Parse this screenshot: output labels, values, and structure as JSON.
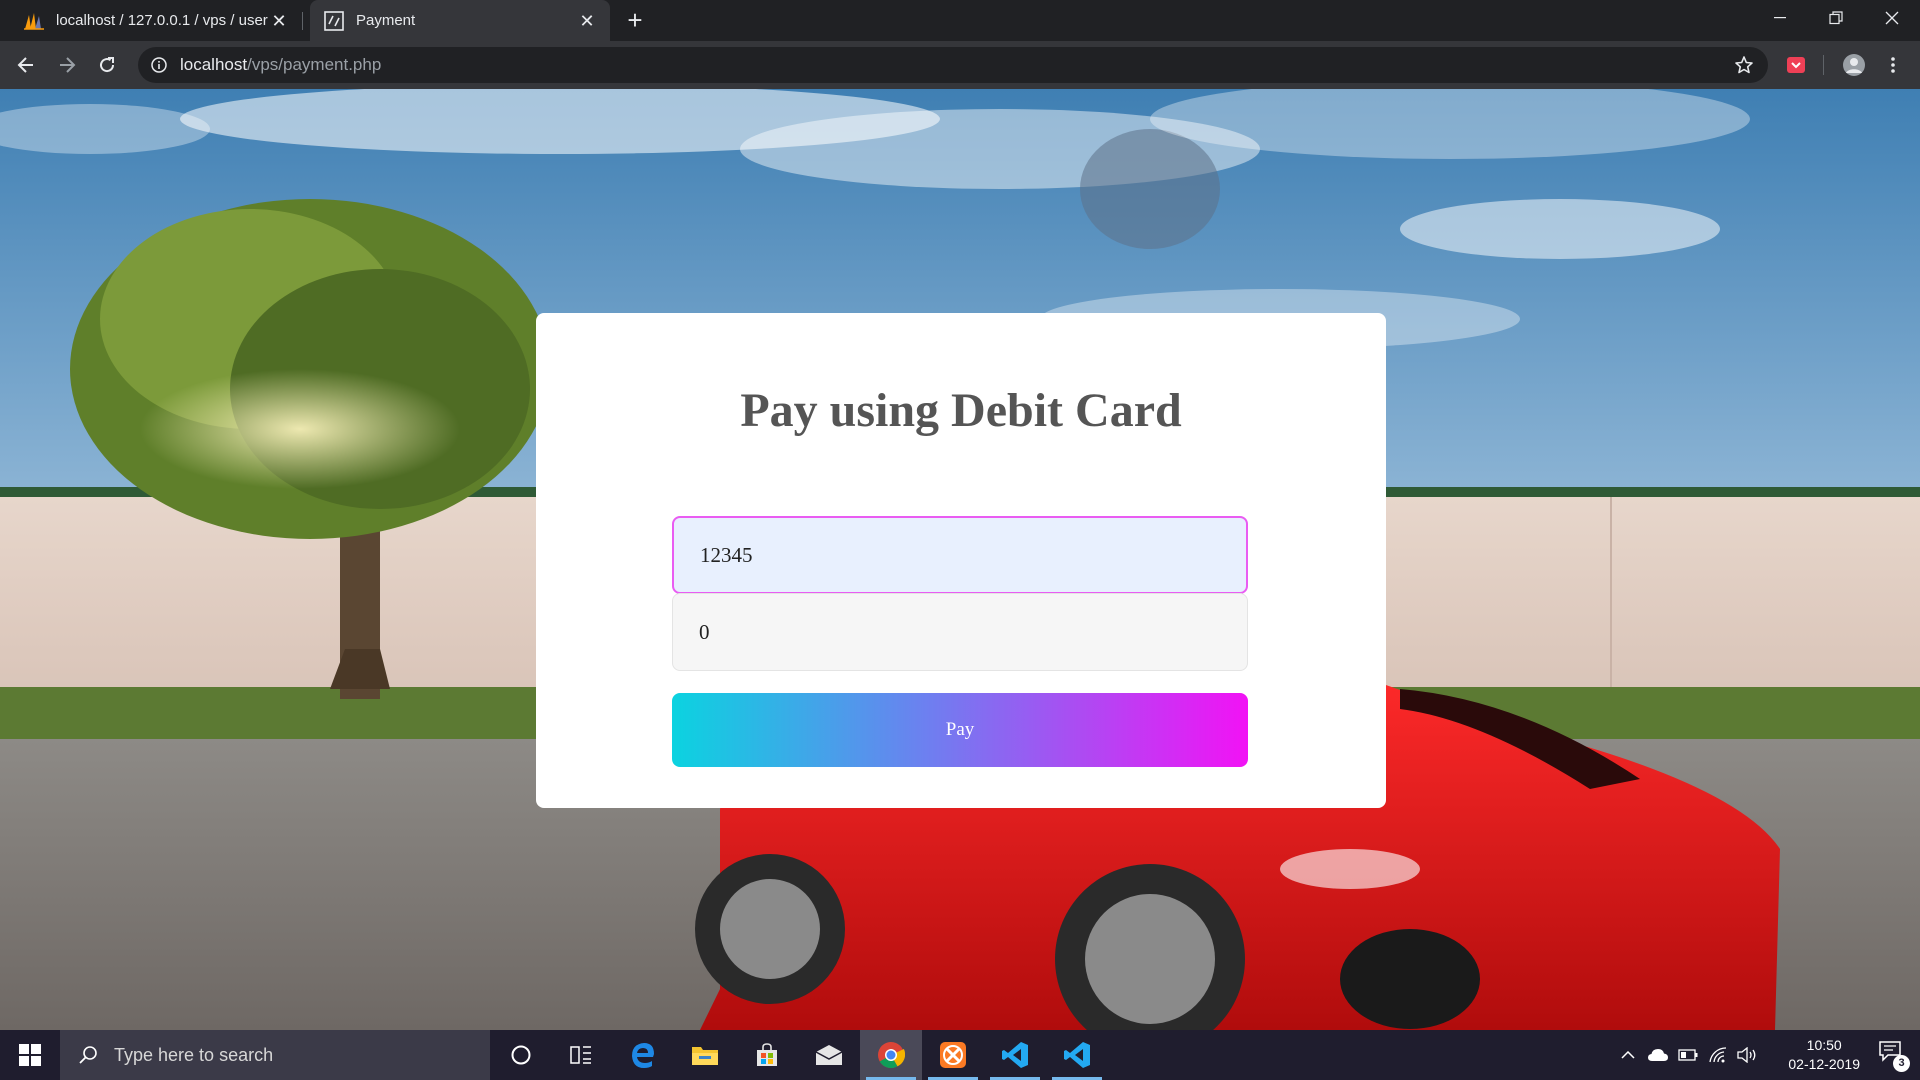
{
  "browser": {
    "tabs": [
      {
        "title": "localhost / 127.0.0.1 / vps / user",
        "favicon": "phpmyadmin-icon",
        "active": false
      },
      {
        "title": "Payment",
        "favicon": "payment-site-icon",
        "active": true
      }
    ],
    "url_host": "localhost",
    "url_path": "/vps/payment.php"
  },
  "page": {
    "title": "Pay using Debit Card",
    "card_number_value": "12345",
    "pin_value": "0",
    "pay_label": "Pay",
    "colors": {
      "gradient_start": "#0bd3e0",
      "gradient_end": "#f212f5",
      "focus_border": "#e95cf2",
      "card_bg": "#ffffff"
    }
  },
  "taskbar": {
    "search_placeholder": "Type here to search",
    "apps": [
      "cortana-icon",
      "task-view-icon",
      "edge-icon",
      "file-explorer-icon",
      "store-icon",
      "mail-icon",
      "chrome-icon",
      "xampp-icon",
      "vscode-icon",
      "vscode-icon"
    ],
    "time": "10:50",
    "date": "02-12-2019",
    "notification_count": "3"
  }
}
